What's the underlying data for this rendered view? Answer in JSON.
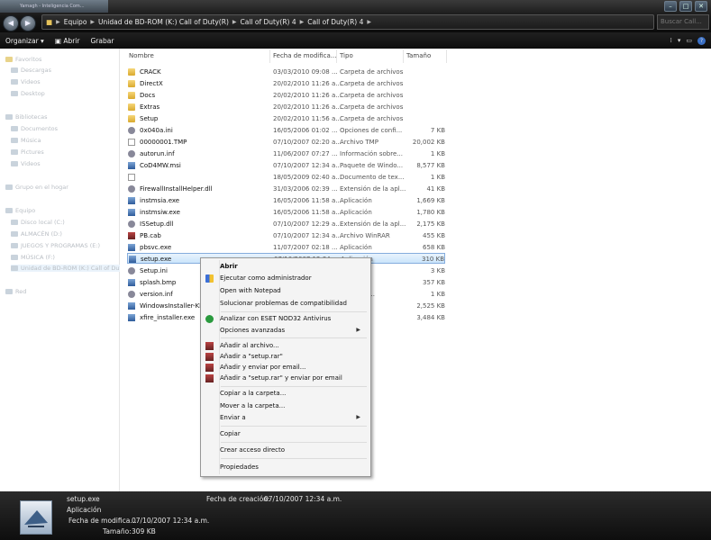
{
  "window": {
    "tab_title": "Yamagh - Inteligencia Com...",
    "search_placeholder": "Buscar Call...",
    "breadcrumb": [
      "Equipo",
      "Unidad de BD-ROM (K:) Call of Duty(R)",
      "Call of Duty(R) 4",
      "Call of Duty(R) 4"
    ]
  },
  "toolbar": {
    "organize": "Organizar",
    "open": "Abrir",
    "burn": "Grabar"
  },
  "nav": [
    "Favoritos",
    "Descargas",
    "Videos",
    "Desktop",
    "Bibliotecas",
    "Documentos",
    "Música",
    "Pictures",
    "Videos",
    "Grupo en el hogar",
    "Equipo",
    "Disco local (C:)",
    "ALMACÉN (D:)",
    "JUEGOS Y PROGRAMAS (E:)",
    "MÚSICA (F:)",
    "Unidad de BD-ROM (K:) Call of Duty(R)",
    "Red"
  ],
  "columns": {
    "name": "Nombre",
    "date": "Fecha de modifica...",
    "type": "Tipo",
    "size": "Tamaño"
  },
  "files": [
    {
      "name": "CRACK",
      "date": "03/03/2010 09:08 ...",
      "type": "Carpeta de archivos",
      "size": "",
      "icon": "folder-icon"
    },
    {
      "name": "DirectX",
      "date": "20/02/2010 11:26 a...",
      "type": "Carpeta de archivos",
      "size": "",
      "icon": "folder-icon"
    },
    {
      "name": "Docs",
      "date": "20/02/2010 11:26 a...",
      "type": "Carpeta de archivos",
      "size": "",
      "icon": "folder-icon"
    },
    {
      "name": "Extras",
      "date": "20/02/2010 11:26 a...",
      "type": "Carpeta de archivos",
      "size": "",
      "icon": "folder-icon"
    },
    {
      "name": "Setup",
      "date": "20/02/2010 11:56 a...",
      "type": "Carpeta de archivos",
      "size": "",
      "icon": "folder-icon"
    },
    {
      "name": "0x040a.ini",
      "date": "16/05/2006 01:02 ...",
      "type": "Opciones de confi...",
      "size": "7 KB",
      "icon": "settings-file-icon"
    },
    {
      "name": "00000001.TMP",
      "date": "07/10/2007 02:20 a...",
      "type": "Archivo TMP",
      "size": "20,002 KB",
      "icon": "document-icon"
    },
    {
      "name": "autorun.inf",
      "date": "11/06/2007 07:27 ...",
      "type": "Información sobre...",
      "size": "1 KB",
      "icon": "settings-file-icon"
    },
    {
      "name": "CoD4MW.msi",
      "date": "07/10/2007 12:34 a...",
      "type": "Paquete de Windo...",
      "size": "8,577 KB",
      "icon": "installer-icon"
    },
    {
      "name": "",
      "date": "18/05/2009 02:40 a...",
      "type": "Documento de tex...",
      "size": "1 KB",
      "icon": "document-icon"
    },
    {
      "name": "FirewallInstallHelper.dll",
      "date": "31/03/2006 02:39 ...",
      "type": "Extensión de la apl...",
      "size": "41 KB",
      "icon": "dll-icon"
    },
    {
      "name": "instmsia.exe",
      "date": "16/05/2006 11:58 a...",
      "type": "Aplicación",
      "size": "1,669 KB",
      "icon": "application-icon"
    },
    {
      "name": "instmsiw.exe",
      "date": "16/05/2006 11:58 a...",
      "type": "Aplicación",
      "size": "1,780 KB",
      "icon": "application-icon"
    },
    {
      "name": "ISSetup.dll",
      "date": "07/10/2007 12:29 a...",
      "type": "Extensión de la apl...",
      "size": "2,175 KB",
      "icon": "dll-icon"
    },
    {
      "name": "PB.cab",
      "date": "07/10/2007 12:34 a...",
      "type": "Archivo WinRAR",
      "size": "455 KB",
      "icon": "winrar-icon"
    },
    {
      "name": "pbsvc.exe",
      "date": "11/07/2007 02:18 ...",
      "type": "Aplicación",
      "size": "658 KB",
      "icon": "application-icon"
    },
    {
      "name": "setup.exe",
      "date": "07/10/2007 12:34 a...",
      "type": "Aplicación",
      "size": "310 KB",
      "icon": "application-icon"
    },
    {
      "name": "Setup.ini",
      "date": "",
      "type": "",
      "size": "3 KB",
      "icon": "settings-file-icon"
    },
    {
      "name": "splash.bmp",
      "date": "",
      "type": "TMP",
      "size": "357 KB",
      "icon": "image-icon"
    },
    {
      "name": "version.inf",
      "date": "",
      "type": "ión sobre...",
      "size": "1 KB",
      "icon": "settings-file-icon"
    },
    {
      "name": "WindowsInstaller-KB",
      "date": "",
      "type": "",
      "size": "2,525 KB",
      "icon": "installer-icon"
    },
    {
      "name": "xfire_installer.exe",
      "date": "",
      "type": "",
      "size": "3,484 KB",
      "icon": "application-icon"
    }
  ],
  "context_menu": [
    {
      "label": "Abrir",
      "bold": true,
      "icon": ""
    },
    {
      "label": "Ejecutar como administrador",
      "icon": "shield-icon"
    },
    {
      "label": "Open with Notepad",
      "icon": ""
    },
    {
      "label": "Solucionar problemas de compatibilidad",
      "icon": ""
    },
    {
      "sep": true
    },
    {
      "label": "Analizar con ESET NOD32 Antivirus",
      "icon": "eset-icon"
    },
    {
      "label": "Opciones avanzadas",
      "icon": "",
      "submenu": true
    },
    {
      "sep": true
    },
    {
      "label": "Añadir al archivo...",
      "icon": "winrar-icon"
    },
    {
      "label": "Añadir a \"setup.rar\"",
      "icon": "winrar-icon"
    },
    {
      "label": "Añadir y enviar por email...",
      "icon": "winrar-icon"
    },
    {
      "label": "Añadir a \"setup.rar\" y enviar por email",
      "icon": "winrar-icon"
    },
    {
      "sep": true
    },
    {
      "label": "Copiar a la carpeta...",
      "icon": ""
    },
    {
      "label": "Mover a la carpeta...",
      "icon": ""
    },
    {
      "label": "Enviar a",
      "icon": "",
      "submenu": true
    },
    {
      "sep": true
    },
    {
      "label": "Copiar",
      "icon": ""
    },
    {
      "sep": true
    },
    {
      "label": "Crear acceso directo",
      "icon": ""
    },
    {
      "sep": true
    },
    {
      "label": "Propiedades",
      "icon": ""
    }
  ],
  "details": {
    "filename": "setup.exe",
    "type": "Aplicación",
    "modified_label": "Fecha de modifica...",
    "modified_value": "07/10/2007 12:34 a.m.",
    "size_label": "Tamaño:",
    "size_value": "309 KB",
    "created_label": "Fecha de creación:",
    "created_value": "07/10/2007 12:34 a.m."
  }
}
